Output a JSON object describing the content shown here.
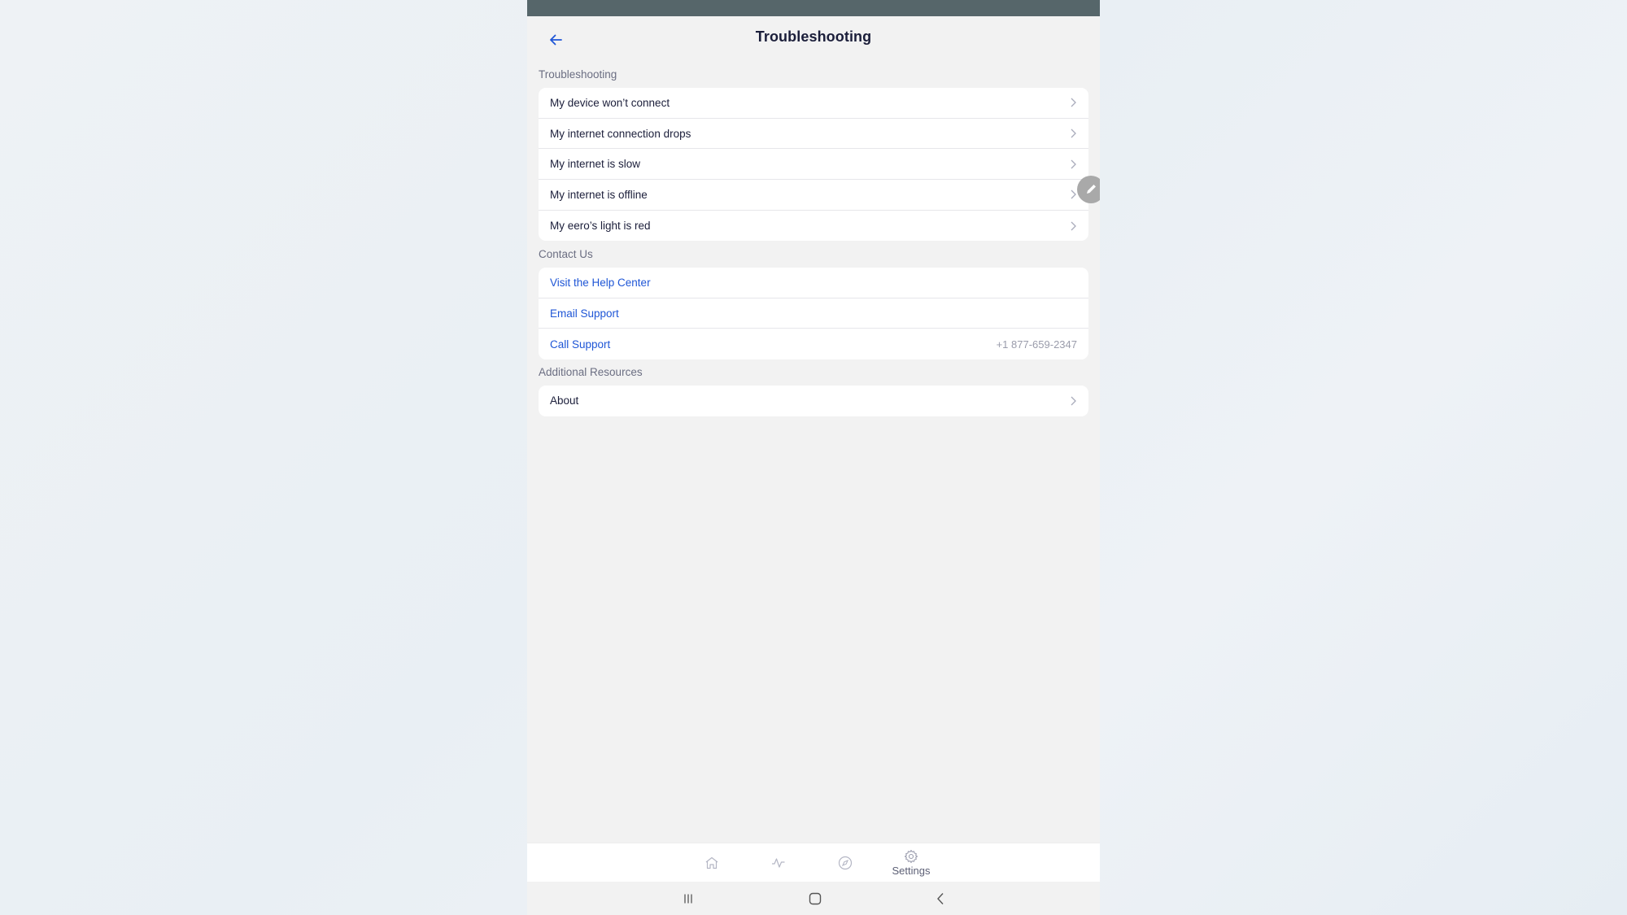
{
  "header": {
    "title": "Troubleshooting",
    "back_icon": "arrow-left-icon"
  },
  "sections": [
    {
      "label": "Troubleshooting",
      "items": [
        {
          "label": "My device won’t connect",
          "icon": "chevron-right-icon"
        },
        {
          "label": "My internet connection drops",
          "icon": "chevron-right-icon"
        },
        {
          "label": "My internet is slow",
          "icon": "chevron-right-icon"
        },
        {
          "label": "My internet is offline",
          "icon": "chevron-right-icon"
        },
        {
          "label": "My eero’s light is red",
          "icon": "chevron-right-icon"
        }
      ]
    },
    {
      "label": "Contact Us",
      "items": [
        {
          "label": "Visit the Help Center"
        },
        {
          "label": "Email Support"
        },
        {
          "label": "Call Support",
          "value": "+1 877-659-2347"
        }
      ]
    },
    {
      "label": "Additional Resources",
      "items": [
        {
          "label": "About",
          "icon": "chevron-right-icon"
        }
      ]
    }
  ],
  "floating_button": {
    "icon": "pencil-icon"
  },
  "bottom_nav": {
    "items": [
      {
        "name": "home",
        "icon": "home-icon",
        "label": ""
      },
      {
        "name": "activity",
        "icon": "activity-icon",
        "label": ""
      },
      {
        "name": "discover",
        "icon": "compass-icon",
        "label": ""
      },
      {
        "name": "settings",
        "icon": "gear-icon",
        "label": "Settings",
        "active": true
      }
    ]
  },
  "system_nav": {
    "recents_icon": "recents-icon",
    "home_icon": "home-button-icon",
    "back_icon": "back-chevron-icon"
  },
  "colors": {
    "accent": "#1f56d6",
    "text_primary": "#1b1e3a",
    "text_secondary": "#6b6e82",
    "status_bar": "#56666a",
    "background": "#f2f2f2"
  }
}
